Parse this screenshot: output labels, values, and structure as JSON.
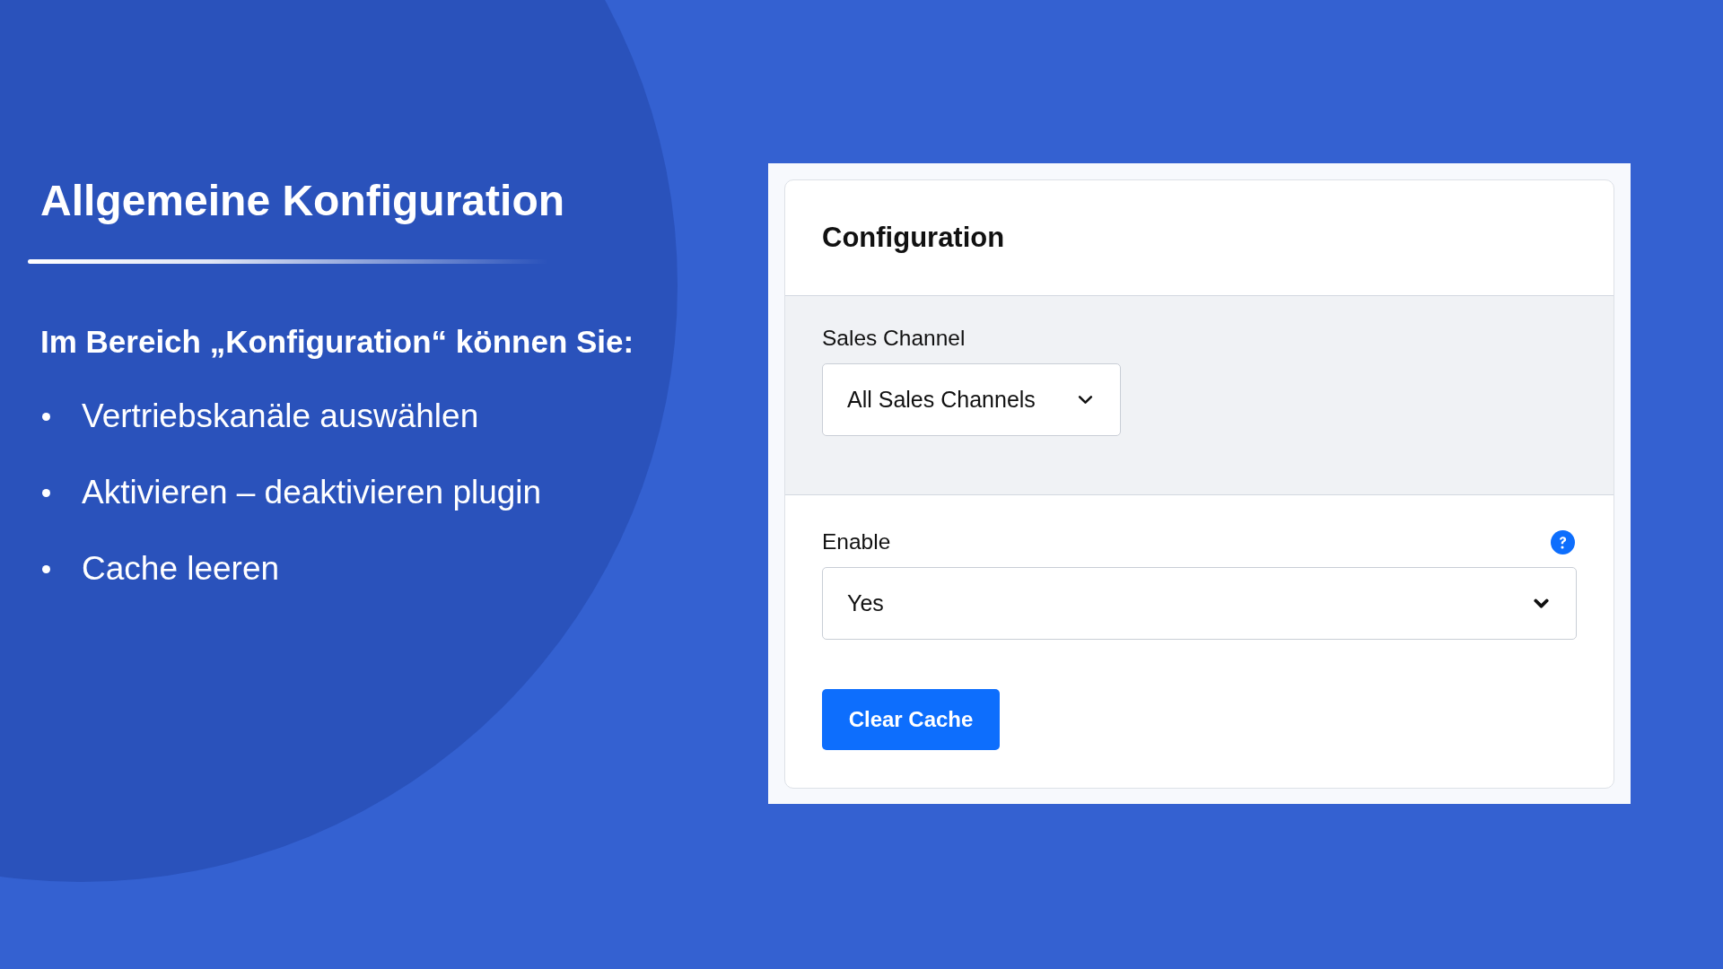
{
  "slide": {
    "title": "Allgemeine Konfiguration",
    "intro": "Im Bereich „Konfiguration“ können Sie:",
    "bullets": [
      "Vertriebskanäle auswählen",
      "Aktivieren – deaktivieren plugin",
      "Cache leeren"
    ]
  },
  "config_panel": {
    "title": "Configuration",
    "sections": [
      {
        "kind": "scope",
        "label": "Sales Channel",
        "value": "All Sales Channels",
        "help": false
      },
      {
        "kind": "setting",
        "label": "Enable",
        "value": "Yes",
        "help": true,
        "buttons": [
          "Clear Cache"
        ]
      }
    ]
  }
}
